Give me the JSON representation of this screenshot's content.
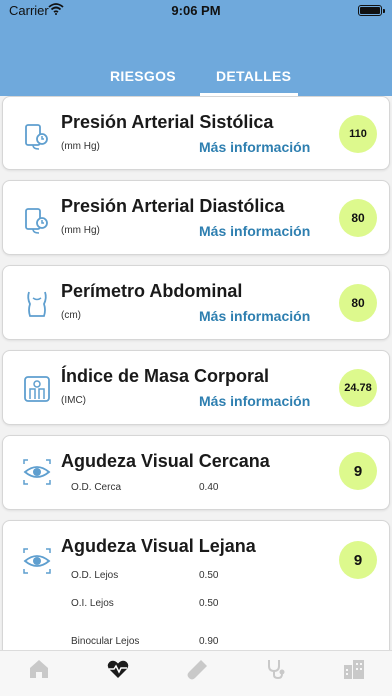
{
  "status_bar": {
    "carrier": "Carrier",
    "time": "9:06 PM"
  },
  "tabs": [
    {
      "label": "RIESGOS",
      "selected": false
    },
    {
      "label": "DETALLES",
      "selected": true
    }
  ],
  "cards": [
    {
      "icon": "blood-pressure-monitor-icon",
      "title": "Presión Arterial Sistólica",
      "unit": "(mm Hg)",
      "more": "Más información",
      "value": "110"
    },
    {
      "icon": "blood-pressure-monitor-icon",
      "title": "Presión Arterial Diastólica",
      "unit": "(mm Hg)",
      "more": "Más información",
      "value": "80"
    },
    {
      "icon": "torso-icon",
      "title": "Perímetro Abdominal",
      "unit": "(cm)",
      "more": "Más información",
      "value": "80"
    },
    {
      "icon": "scale-icon",
      "title": "Índice de Masa Corporal",
      "unit": "(IMC)",
      "more": "Más información",
      "value": "24.78"
    },
    {
      "icon": "eye-icon",
      "title": "Agudeza Visual Cercana",
      "value": "9",
      "rows": [
        {
          "label": "O.D. Cerca",
          "value": "0.40"
        }
      ]
    },
    {
      "icon": "eye-icon",
      "title": "Agudeza Visual Lejana",
      "value": "9",
      "rows": [
        {
          "label": "O.D. Lejos",
          "value": "0.50"
        },
        {
          "label": "O.I. Lejos",
          "value": "0.50"
        },
        {
          "label": "Binocular Lejos",
          "value": "0.90"
        }
      ]
    }
  ],
  "bottom_tabs": [
    {
      "icon": "home-icon",
      "active": false
    },
    {
      "icon": "heart-pulse-icon",
      "active": true
    },
    {
      "icon": "test-tube-icon",
      "active": false
    },
    {
      "icon": "stethoscope-icon",
      "active": false
    },
    {
      "icon": "city-icon",
      "active": false
    }
  ],
  "colors": {
    "header": "#6fa9dc",
    "badge": "#ddf98d",
    "link": "#2e7fb0",
    "icon": "#5f9fcf"
  }
}
